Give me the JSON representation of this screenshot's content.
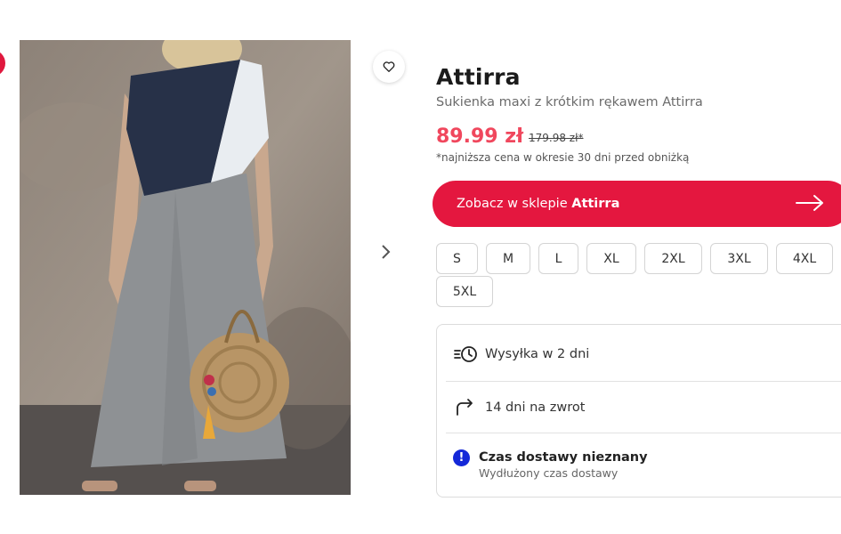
{
  "product": {
    "brand": "Attirra",
    "name": "Sukienka maxi z krótkim rękawem Attirra",
    "price": "89.99 zł",
    "old_price": "179.98 zł*",
    "price_note": "*najniższa cena w okresie 30 dni przed obniżką"
  },
  "shop_button": {
    "prefix": "Zobacz w sklepie",
    "shop": "Attirra"
  },
  "sizes": [
    "S",
    "M",
    "L",
    "XL",
    "2XL",
    "3XL",
    "4XL",
    "5XL"
  ],
  "info": {
    "shipping": "Wysyłka w 2 dni",
    "returns": "14 dni na zwrot",
    "delivery_title": "Czas dostawy nieznany",
    "delivery_sub": "Wydłużony czas dostawy"
  },
  "icons": {
    "favorite": "heart-icon",
    "next": "chevron-right-icon",
    "shop_arrow": "arrow-right-icon",
    "shipping": "fast-clock-icon",
    "returns": "return-arrow-icon",
    "delivery": "exclamation-icon"
  },
  "colors": {
    "accent": "#e4173f",
    "price": "#f0475d",
    "warning": "#1428d8"
  }
}
